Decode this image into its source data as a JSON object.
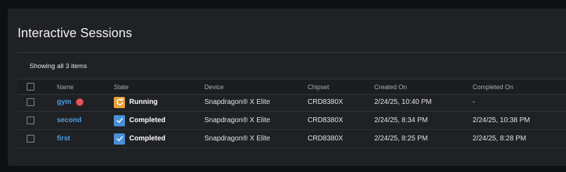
{
  "page": {
    "title": "Interactive Sessions",
    "showing": "Showing all 3 items"
  },
  "columns": {
    "name": "Name",
    "state": "State",
    "device": "Device",
    "chipset": "Chipset",
    "created_on": "Created On",
    "completed_on": "Completed On"
  },
  "rows": [
    {
      "name": "gym",
      "state": "Running",
      "state_icon": "refresh-icon",
      "has_status_dot": true,
      "device": "Snapdragon® X Elite",
      "chipset": "CRD8380X",
      "created_on": "2/24/25, 10:40 PM",
      "completed_on": "-"
    },
    {
      "name": "second",
      "state": "Completed",
      "state_icon": "check-icon",
      "has_status_dot": false,
      "device": "Snapdragon® X Elite",
      "chipset": "CRD8380X",
      "created_on": "2/24/25, 8:34 PM",
      "completed_on": "2/24/25, 10:38 PM"
    },
    {
      "name": "first",
      "state": "Completed",
      "state_icon": "check-icon",
      "has_status_dot": false,
      "device": "Snapdragon® X Elite",
      "chipset": "CRD8380X",
      "created_on": "2/24/25, 8:25 PM",
      "completed_on": "2/24/25, 8:28 PM"
    }
  ],
  "colors": {
    "link": "#4f9fe3",
    "running": "#e8a33b",
    "completed": "#4a8fd8",
    "status_dot": "#e8555a"
  }
}
